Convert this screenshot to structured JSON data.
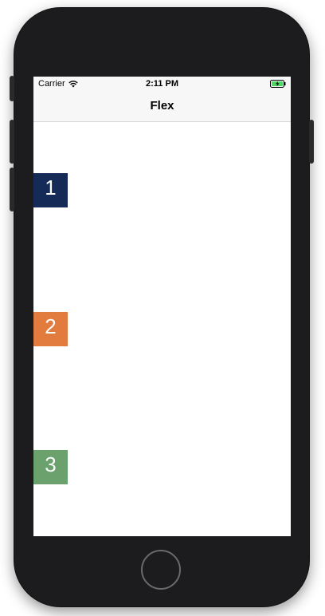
{
  "status_bar": {
    "carrier": "Carrier",
    "time": "2:11 PM",
    "icons": [
      "wifi-icon",
      "battery-charging-icon"
    ]
  },
  "nav_bar": {
    "title": "Flex"
  },
  "boxes": [
    {
      "label": "1",
      "color": "#152a56"
    },
    {
      "label": "2",
      "color": "#e27c3e"
    },
    {
      "label": "3",
      "color": "#6aa16d"
    }
  ],
  "colors": {
    "device_body": "#1c1c1e",
    "battery": "#4cd964"
  }
}
